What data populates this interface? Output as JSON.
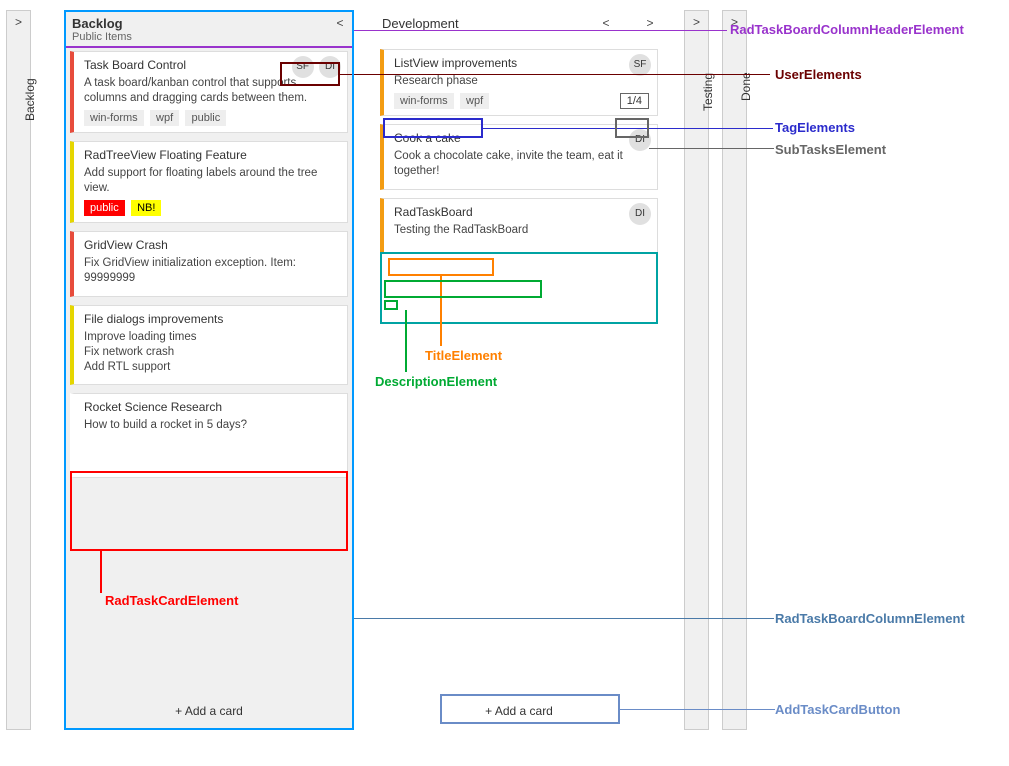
{
  "collapsed_left": {
    "label": "Backlog"
  },
  "backlog": {
    "title": "Backlog",
    "subtitle": "Public Items",
    "add": "+ Add a card",
    "cards": [
      {
        "title": "Task Board Control",
        "desc": "A task board/kanban control that supports columns and dragging cards between them.",
        "tags": [
          "win-forms",
          "wpf",
          "public"
        ],
        "users": [
          "SF",
          "DI"
        ],
        "accent": "#e74c3c"
      },
      {
        "title": "RadTreeView Floating Feature",
        "desc": "Add support for floating labels around the tree view.",
        "tags_styled": [
          {
            "t": "public",
            "c": "red"
          },
          {
            "t": "NB!",
            "c": "yellow"
          }
        ],
        "accent": "#e5d600"
      },
      {
        "title": "GridView Crash",
        "desc": "Fix GridView initialization exception. Item: 99999999",
        "accent": "#e74c3c"
      },
      {
        "title": "File dialogs improvements",
        "desc_lines": [
          "Improve loading times",
          "Fix network crash",
          "Add RTL support"
        ],
        "accent": "#e5d600"
      },
      {
        "title": "Rocket Science Research",
        "desc": "How to build a rocket in 5 days?",
        "accent": "#ffffff"
      }
    ]
  },
  "dev": {
    "title": "Development",
    "add": "+ Add a card",
    "cards": [
      {
        "title": "ListView improvements",
        "desc": "Research phase",
        "tags": [
          "win-forms",
          "wpf"
        ],
        "users": [
          "SF"
        ],
        "subtasks": "1/4",
        "accent": "#f39c12"
      },
      {
        "title": "Cook a cake",
        "desc": "Cook a chocolate cake, invite the team, eat it together!",
        "users": [
          "DI"
        ],
        "accent": "#f39c12"
      },
      {
        "title": "RadTaskBoard",
        "desc": "Testing the RadTaskBoard",
        "users": [
          "DI"
        ],
        "accent": "#f39c12"
      }
    ]
  },
  "collapsed_right1": {
    "label": "Testing"
  },
  "collapsed_right2": {
    "label": "Done"
  },
  "annotations": {
    "header": "RadTaskBoardColumnHeaderElement",
    "users": "UserElements",
    "tags": "TagElements",
    "subtasks": "SubTasksElement",
    "card": "RadTaskCardElement",
    "title": "TitleElement",
    "desc": "DescriptionElement",
    "column": "RadTaskBoardColumnElement",
    "add": "AddTaskCardButton"
  }
}
